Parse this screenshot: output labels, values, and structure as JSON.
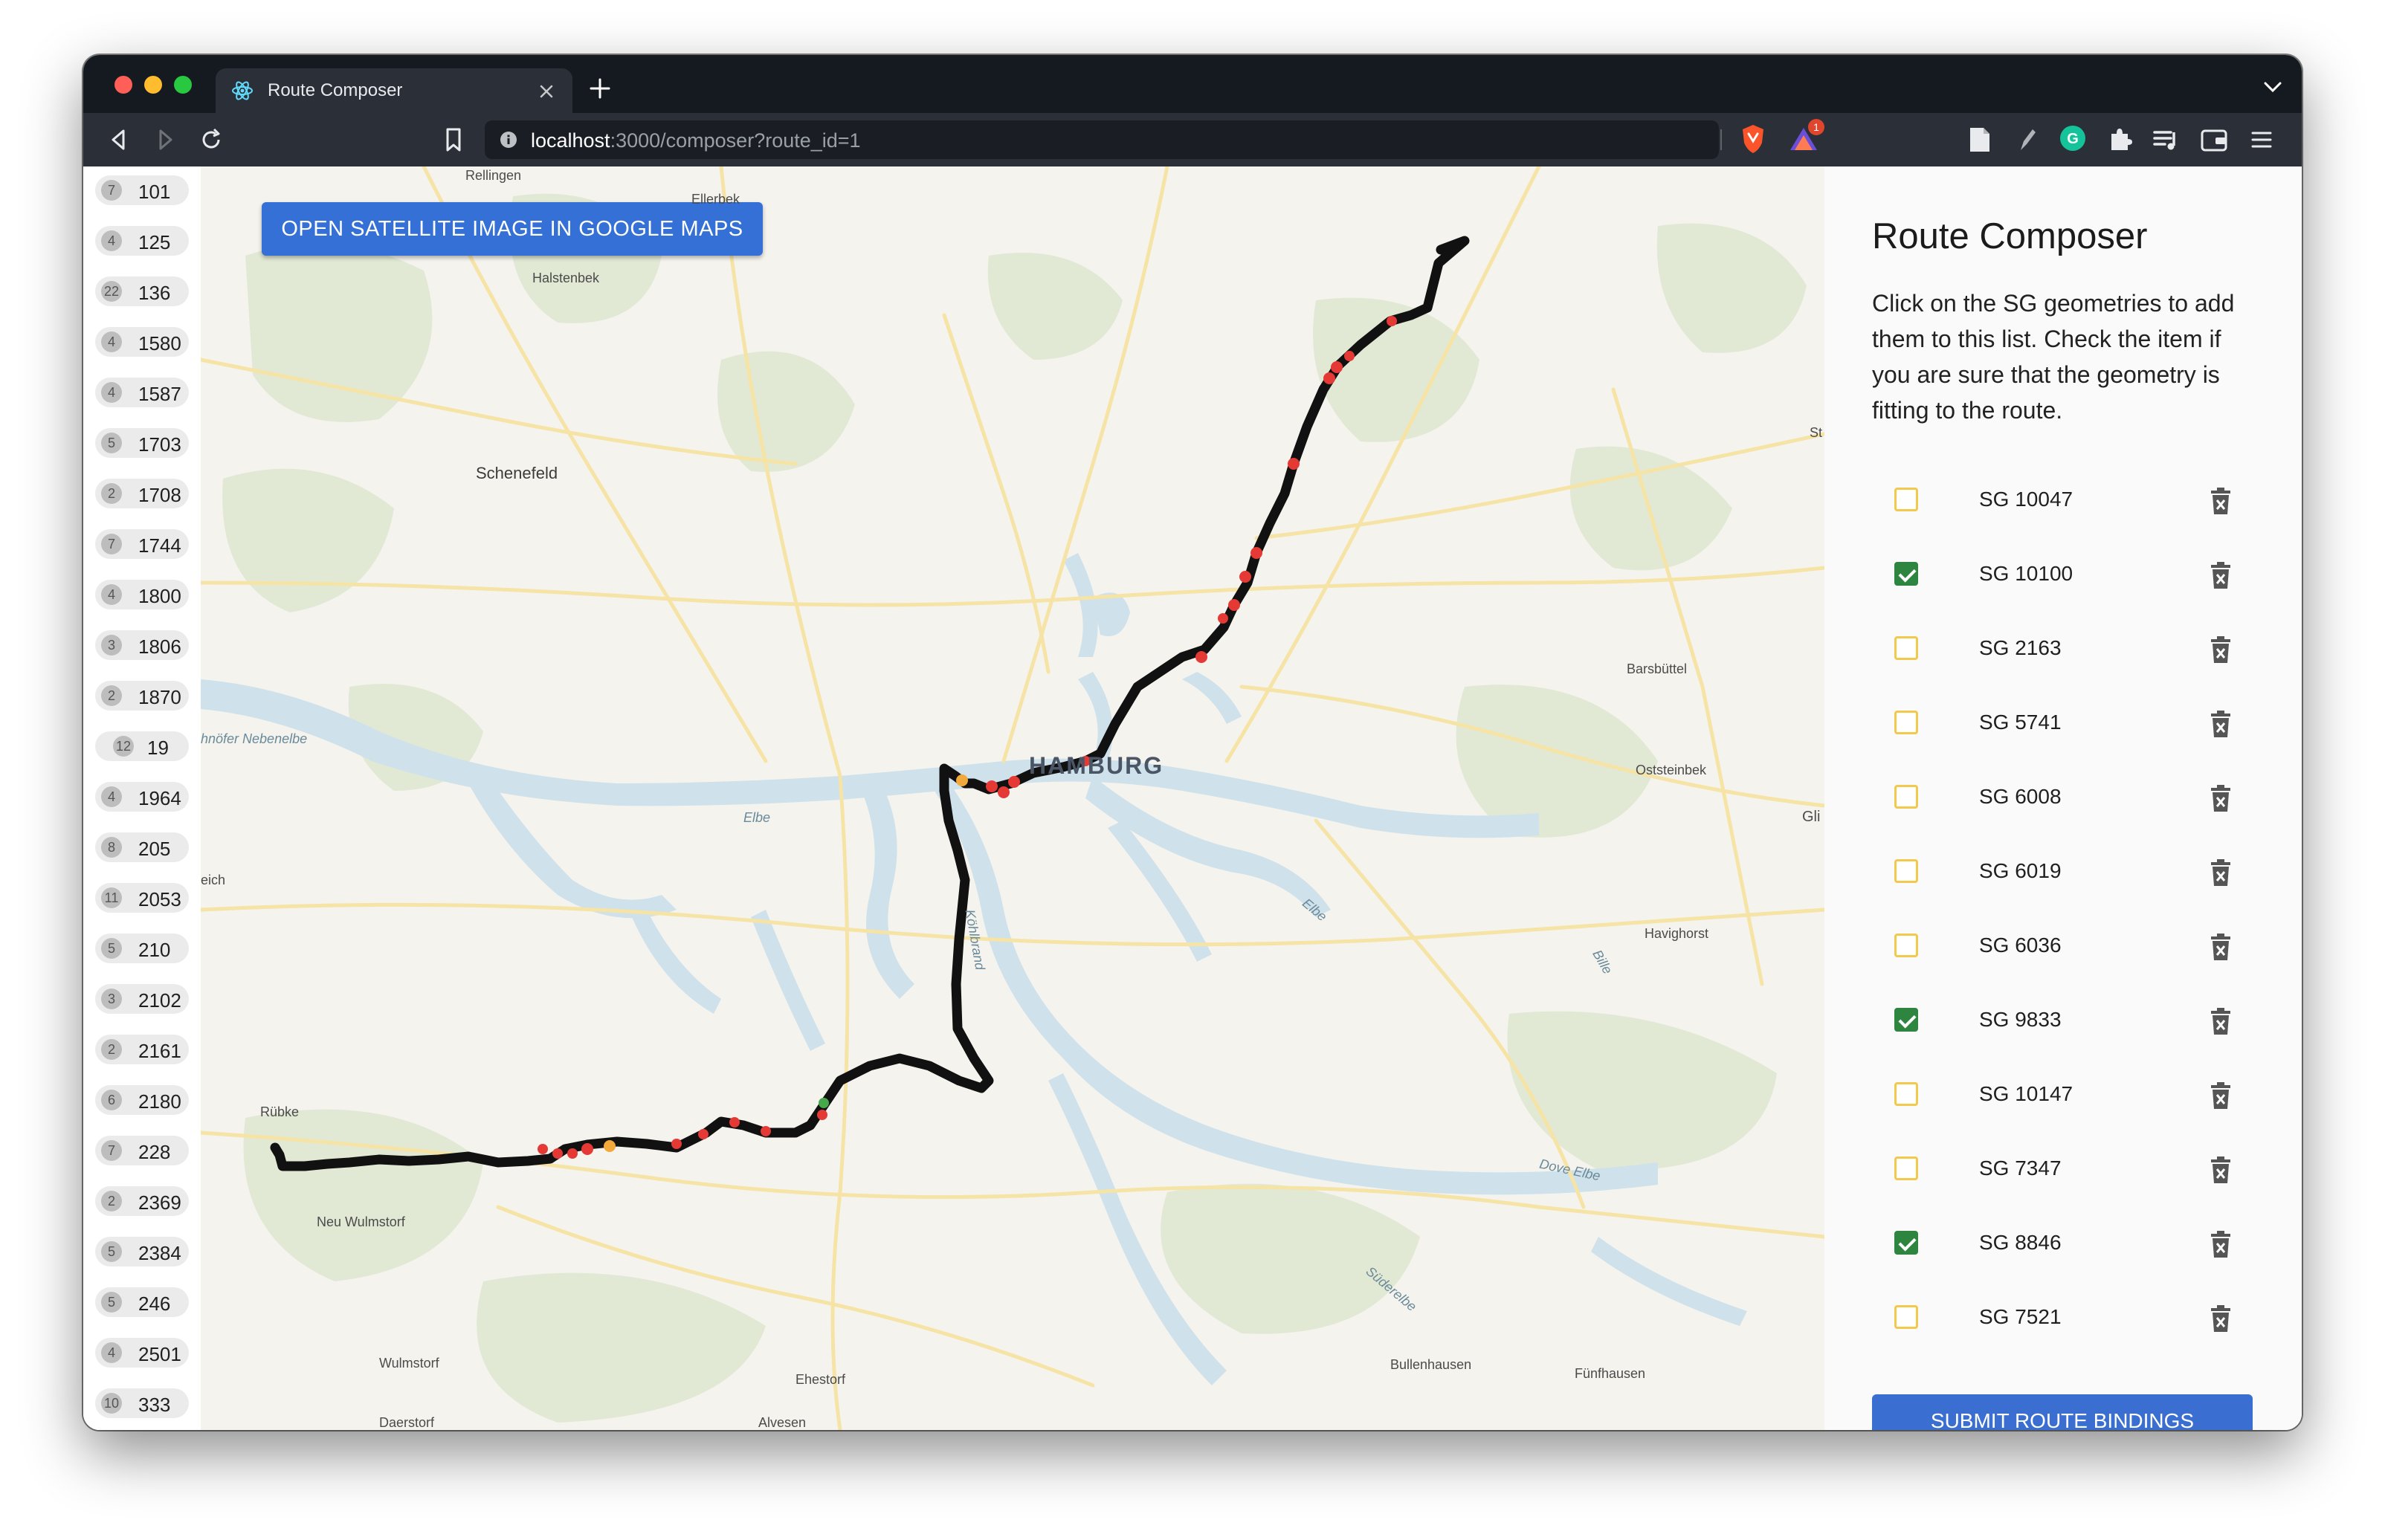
{
  "browser": {
    "tab_title": "Route Composer",
    "url_host": "localhost",
    "url_path": ":3000/composer?route_id=1",
    "notification_count": "1"
  },
  "left_list": [
    {
      "count": "7",
      "label": "101"
    },
    {
      "count": "4",
      "label": "125"
    },
    {
      "count": "22",
      "label": "136"
    },
    {
      "count": "4",
      "label": "1580"
    },
    {
      "count": "4",
      "label": "1587"
    },
    {
      "count": "5",
      "label": "1703"
    },
    {
      "count": "2",
      "label": "1708"
    },
    {
      "count": "7",
      "label": "1744"
    },
    {
      "count": "4",
      "label": "1800"
    },
    {
      "count": "3",
      "label": "1806"
    },
    {
      "count": "2",
      "label": "1870"
    },
    {
      "count": "12",
      "label": "19"
    },
    {
      "count": "4",
      "label": "1964"
    },
    {
      "count": "8",
      "label": "205"
    },
    {
      "count": "11",
      "label": "2053"
    },
    {
      "count": "5",
      "label": "210"
    },
    {
      "count": "3",
      "label": "2102"
    },
    {
      "count": "2",
      "label": "2161"
    },
    {
      "count": "6",
      "label": "2180"
    },
    {
      "count": "7",
      "label": "228"
    },
    {
      "count": "2",
      "label": "2369"
    },
    {
      "count": "5",
      "label": "2384"
    },
    {
      "count": "5",
      "label": "246"
    },
    {
      "count": "4",
      "label": "2501"
    },
    {
      "count": "10",
      "label": "333"
    }
  ],
  "map": {
    "satellite_button": "OPEN SATELLITE IMAGE IN GOOGLE MAPS",
    "places": {
      "rellingen": "Rellingen",
      "ellerbek": "Ellerbek",
      "halstenbek": "Halstenbek",
      "schenefeld": "Schenefeld",
      "hamburg": "HAMBURG",
      "barsbuttel": "Barsbüttel",
      "oststeinbek": "Oststeinbek",
      "havighorst": "Havighorst",
      "rubke": "Rübke",
      "neu_wulmstorf": "Neu Wulmstorf",
      "wulmstorf": "Wulmstorf",
      "daerstorf": "Daerstorf",
      "ehestorf": "Ehestorf",
      "alvesen": "Alvesen",
      "bullenhausen": "Bullenhausen",
      "funfhausen": "Fünfhausen",
      "elbe1": "Elbe",
      "elbe2": "Elbe",
      "dove_elbe": "Dove Elbe",
      "suderelbe": "Süderelbe",
      "bille": "Bille",
      "kohlbrand": "Köhlbrand",
      "nebenelbe": "hnöfer Nebenelbe",
      "eich": "eich",
      "st": "St",
      "gli": "Gli"
    }
  },
  "panel": {
    "title": "Route Composer",
    "description": "Click on the SG geometries to add them to this list. Check the item if you are sure that the geometry is fitting to the route.",
    "items": [
      {
        "label": "SG 10047",
        "checked": false
      },
      {
        "label": "SG 10100",
        "checked": true
      },
      {
        "label": "SG 2163",
        "checked": false
      },
      {
        "label": "SG 5741",
        "checked": false
      },
      {
        "label": "SG 6008",
        "checked": false
      },
      {
        "label": "SG 6019",
        "checked": false
      },
      {
        "label": "SG 6036",
        "checked": false
      },
      {
        "label": "SG 9833",
        "checked": true
      },
      {
        "label": "SG 10147",
        "checked": false
      },
      {
        "label": "SG 7347",
        "checked": false
      },
      {
        "label": "SG 8846",
        "checked": true
      },
      {
        "label": "SG 7521",
        "checked": false
      }
    ],
    "submit_label": "SUBMIT ROUTE BINDINGS"
  },
  "colors": {
    "accent": "#3470d6",
    "check_on": "#2e8540",
    "check_off_border": "#f2c94c",
    "route": "#111111",
    "marker_red": "#e53935",
    "marker_orange": "#f2a93b",
    "water": "#cfe1ea"
  }
}
